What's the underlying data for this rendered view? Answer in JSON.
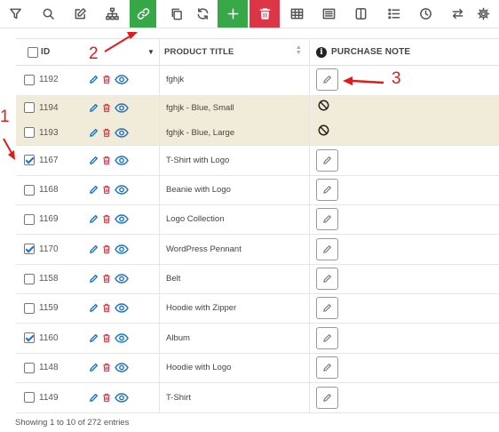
{
  "toolbar": {
    "buttons": [
      {
        "name": "filter-button",
        "icon": "filter-icon"
      },
      {
        "name": "search-button",
        "icon": "search-icon"
      },
      {
        "name": "bulk-edit-button",
        "icon": "edit-icon"
      },
      {
        "name": "hierarchy-button",
        "icon": "sitemap-icon"
      },
      {
        "name": "bind-edit-button",
        "icon": "link-icon",
        "state": "active"
      },
      {
        "name": "duplicate-button",
        "icon": "copy-icon"
      },
      {
        "name": "reload-button",
        "icon": "refresh-icon"
      },
      {
        "name": "add-product-button",
        "icon": "plus-icon"
      },
      {
        "name": "delete-button",
        "icon": "trash-icon"
      },
      {
        "name": "table-view-button",
        "icon": "table-icon"
      },
      {
        "name": "columns-button",
        "icon": "columns-icon"
      },
      {
        "name": "layout-button",
        "icon": "panel-icon"
      },
      {
        "name": "list-button",
        "icon": "list-icon"
      },
      {
        "name": "history-button",
        "icon": "clock-icon"
      },
      {
        "name": "sync-button",
        "icon": "swap-icon"
      },
      {
        "name": "settings-button",
        "icon": "gear-icon"
      }
    ],
    "colors": {
      "active": "#37a748",
      "danger": "#dc3545"
    }
  },
  "table": {
    "headers": {
      "id": "ID",
      "title": "PRODUCT TITLE",
      "note": "PURCHASE NOTE",
      "info_glyph": "i",
      "sort_glyph": "▼"
    },
    "rows": [
      {
        "id": "1192",
        "title": "fghjk",
        "checked": false,
        "variation": false,
        "note": "edit"
      },
      {
        "id": "1194",
        "title": "fghjk - Blue, Small",
        "checked": false,
        "variation": true,
        "note": "disabled"
      },
      {
        "id": "1193",
        "title": "fghjk - Blue, Large",
        "checked": false,
        "variation": true,
        "note": "disabled"
      },
      {
        "id": "1167",
        "title": "T-Shirt with Logo",
        "checked": true,
        "variation": false,
        "note": "edit"
      },
      {
        "id": "1168",
        "title": "Beanie with Logo",
        "checked": false,
        "variation": false,
        "note": "edit"
      },
      {
        "id": "1169",
        "title": "Logo Collection",
        "checked": false,
        "variation": false,
        "note": "edit"
      },
      {
        "id": "1170",
        "title": "WordPress Pennant",
        "checked": true,
        "variation": false,
        "note": "edit"
      },
      {
        "id": "1158",
        "title": "Belt",
        "checked": false,
        "variation": false,
        "note": "edit"
      },
      {
        "id": "1159",
        "title": "Hoodie with Zipper",
        "checked": false,
        "variation": false,
        "note": "edit"
      },
      {
        "id": "1160",
        "title": "Album",
        "checked": true,
        "variation": false,
        "note": "edit"
      },
      {
        "id": "1148",
        "title": "Hoodie with Logo",
        "checked": false,
        "variation": false,
        "note": "edit"
      },
      {
        "id": "1149",
        "title": "T-Shirt",
        "checked": false,
        "variation": false,
        "note": "edit"
      }
    ],
    "row_colors": {
      "variation": "#f1ecd9",
      "edit_icon": "#1a73c8",
      "delete_icon": "#dc3545",
      "view_icon": "#1a73c8"
    }
  },
  "footer": {
    "text": "Showing 1 to 10 of 272 entries"
  },
  "annotations": [
    {
      "label": "1",
      "color": "#e01b1b"
    },
    {
      "label": "2",
      "color": "#e01b1b"
    },
    {
      "label": "3",
      "color": "#e01b1b"
    }
  ]
}
